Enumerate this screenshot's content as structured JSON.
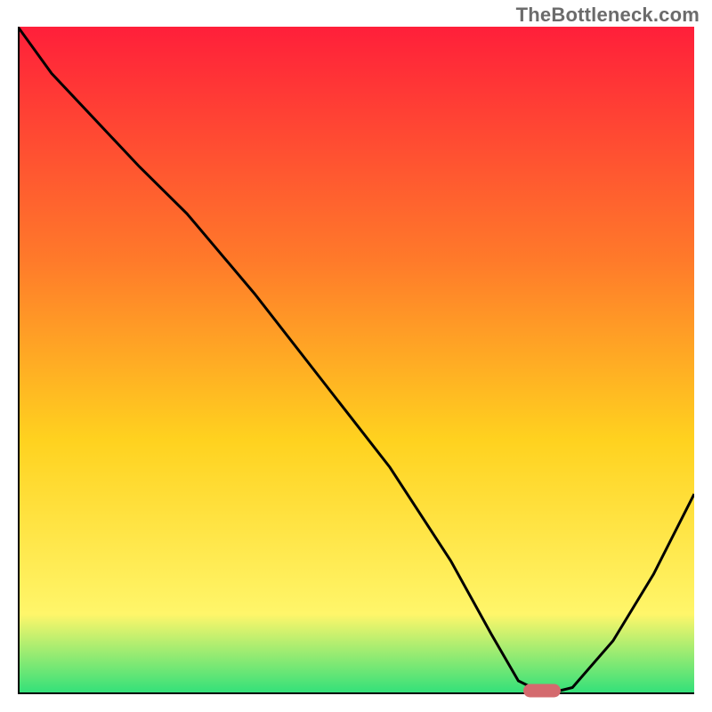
{
  "watermark": "TheBottleneck.com",
  "colors": {
    "gradient_top": "#ff1f3a",
    "gradient_mid1": "#ff7a2a",
    "gradient_mid2": "#ffd21f",
    "gradient_mid3": "#fff66a",
    "gradient_bottom": "#2fe07a",
    "axis": "#000000",
    "curve": "#000000",
    "marker": "#d46a6e"
  },
  "chart_data": {
    "type": "line",
    "title": "",
    "xlabel": "",
    "ylabel": "",
    "xlim": [
      0,
      100
    ],
    "ylim": [
      0,
      100
    ],
    "x": [
      0,
      5,
      18,
      25,
      35,
      45,
      55,
      64,
      70,
      74,
      78,
      82,
      88,
      94,
      100
    ],
    "values": [
      100,
      93,
      79,
      72,
      60,
      47,
      34,
      20,
      9,
      2,
      0,
      1,
      8,
      18,
      30
    ],
    "marker": {
      "x": 77.5,
      "y": 0
    },
    "grid": false,
    "legend": false
  }
}
